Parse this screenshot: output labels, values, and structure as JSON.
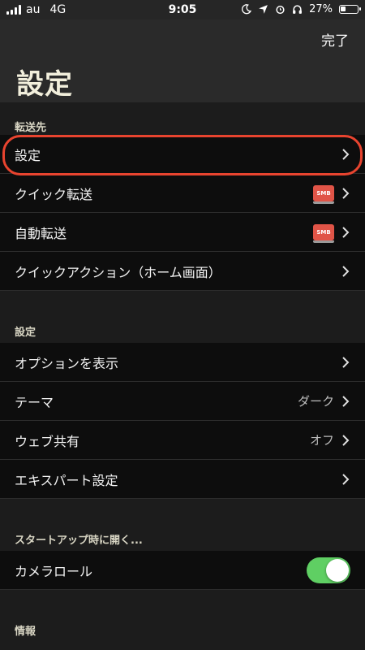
{
  "status_bar": {
    "carrier": "au",
    "network": "4G",
    "time": "9:05",
    "battery": "27%",
    "battery_level": 0.27
  },
  "nav": {
    "done_label": "完了",
    "title": "設定"
  },
  "sections": {
    "transfer": {
      "header": "転送先",
      "rows": [
        {
          "label": "設定"
        },
        {
          "label": "クイック転送",
          "badge": "SMB"
        },
        {
          "label": "自動転送",
          "badge": "SMB"
        },
        {
          "label": "クイックアクション（ホーム画面）"
        }
      ]
    },
    "settings": {
      "header": "設定",
      "rows": [
        {
          "label": "オプションを表示"
        },
        {
          "label": "テーマ",
          "value": "ダーク"
        },
        {
          "label": "ウェブ共有",
          "value": "オフ"
        },
        {
          "label": "エキスパート設定"
        }
      ]
    },
    "startup": {
      "header": "スタートアップ時に開く...",
      "rows": [
        {
          "label": "カメラロール",
          "toggle": true
        }
      ]
    },
    "info": {
      "header": "情報"
    }
  },
  "colors": {
    "highlight": "#e8442f",
    "toggle_on": "#5fcf63",
    "smb_badge": "#e05447"
  }
}
